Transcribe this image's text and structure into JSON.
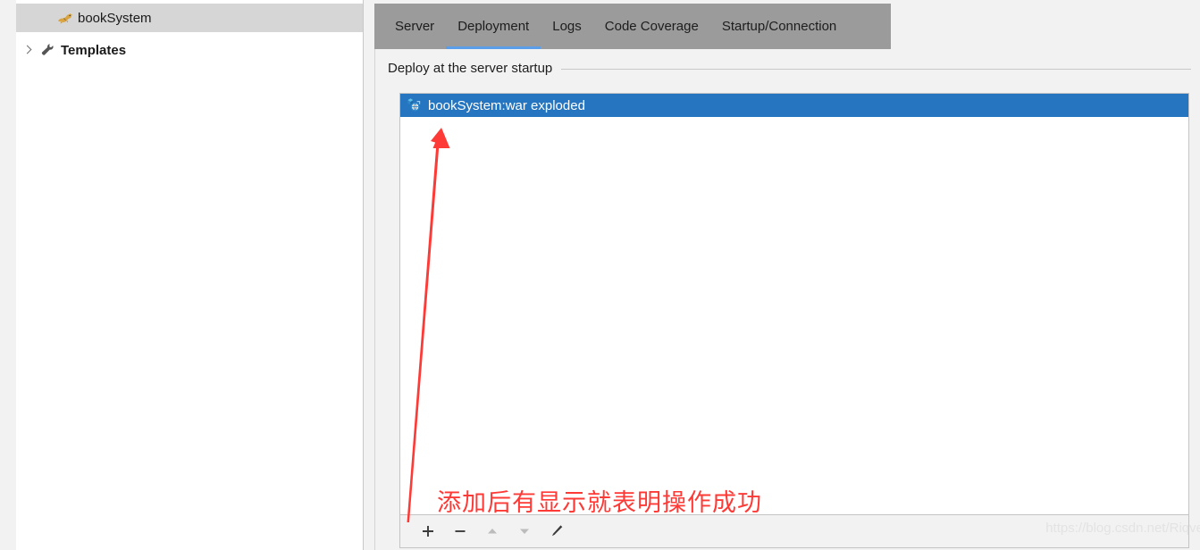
{
  "sidebar": {
    "items": [
      {
        "label": "bookSystem",
        "icon": "tomcat-icon",
        "selected": true,
        "expandable": false
      },
      {
        "label": "Templates",
        "icon": "wrench-icon",
        "selected": false,
        "expandable": true,
        "expanded": false
      }
    ]
  },
  "tabs": [
    {
      "label": "Server",
      "active": false
    },
    {
      "label": "Deployment",
      "active": true
    },
    {
      "label": "Logs",
      "active": false
    },
    {
      "label": "Code Coverage",
      "active": false
    },
    {
      "label": "Startup/Connection",
      "active": false
    }
  ],
  "deployment": {
    "group_label": "Deploy at the server startup",
    "artifacts": [
      {
        "label": "bookSystem:war exploded",
        "icon": "artifact-war-exploded-icon",
        "selected": true
      }
    ],
    "toolbar": {
      "add_label": "+",
      "remove_label": "−",
      "move_up_label": "▲",
      "move_down_label": "▼",
      "edit_label": "✎"
    }
  },
  "annotations": {
    "note_text": "添加后有显示就表明操作成功",
    "arrow_color": "#fd3a36",
    "watermark": "https://blog.csdn.net/Riqve"
  },
  "colors": {
    "tab_strip_bg": "#9b9b9b",
    "tab_active_underline": "#5a9de8",
    "selection_blue": "#2575c0",
    "sidebar_selection": "#d6d6d6",
    "panel_bg": "#f2f2f2",
    "list_bg": "#ffffff"
  }
}
